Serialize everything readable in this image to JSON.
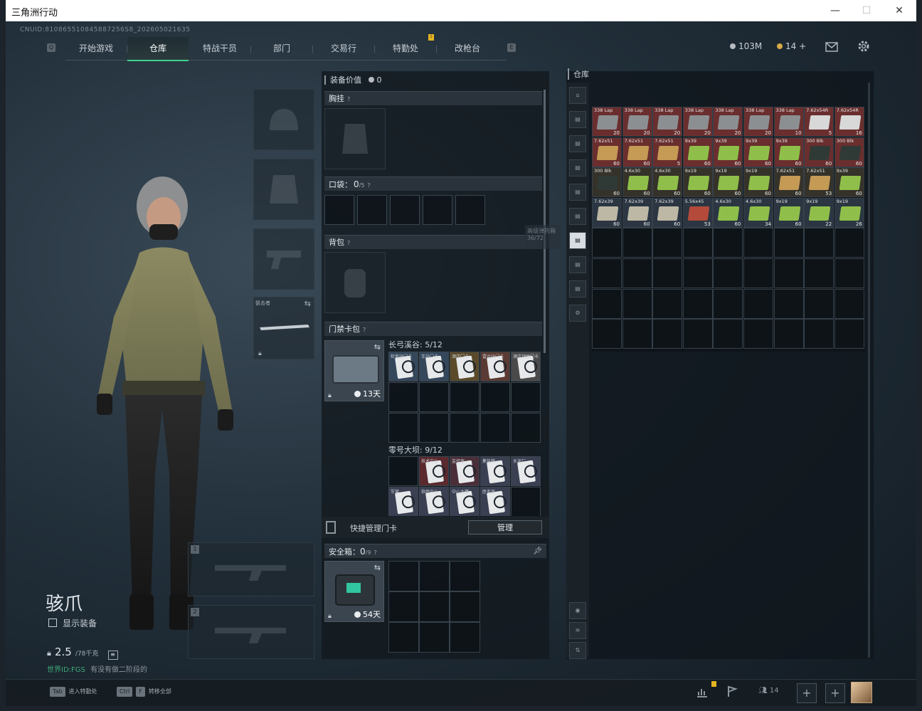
{
  "window": {
    "title": "三角洲行动",
    "minimize": "—",
    "maximize": "☐",
    "close": "✕"
  },
  "cnuid": "CNUID:810865510845887256S8_202605021635",
  "nav": {
    "left_key": "Q",
    "right_key": "E",
    "tabs": [
      {
        "label": "开始游戏"
      },
      {
        "label": "仓库",
        "active": true
      },
      {
        "label": "特战干员"
      },
      {
        "label": "部门"
      },
      {
        "label": "交易行"
      },
      {
        "label": "特勤处",
        "badge": "!"
      },
      {
        "label": "改枪台"
      }
    ]
  },
  "currency": {
    "silver": "103M",
    "gold": "14 +",
    "mail_icon": "mail-icon",
    "settings_icon": "gear-icon"
  },
  "character": {
    "name": "骇爪",
    "show_gear": "显示装备",
    "weight": "2.5",
    "weight_max": "/78千克",
    "footer_note_a": "世界ID:FGS",
    "footer_note_b": "有没有做二阶段的"
  },
  "left_slots": {
    "sniper_label": "狙击者",
    "slot1": "1",
    "slot2": "2"
  },
  "equipment": {
    "value_label": "装备价值",
    "value": "0",
    "chest_rig": "胸挂",
    "pocket": "口袋：",
    "pocket_count": "0",
    "pocket_max": "/5",
    "backpack": "背包",
    "keycard_bag": "门禁卡包",
    "keycard_days": "13天",
    "map1_label": "长弓溪谷: 5/12",
    "map2_label": "零号大坝: 9/12",
    "quick_manage": "快捷管理门卡",
    "manage_btn": "管理",
    "safebox": "安全箱：",
    "safebox_count": "0",
    "safebox_max": "/9",
    "safebox_days": "54天",
    "tooltip_a": "高级弹药箱",
    "tooltip_b": "36/72",
    "map1_cards": [
      "检查站门卡",
      "车站门卡",
      "酒店门卡",
      "雷达站门卡",
      "酒店顶层门卡"
    ],
    "map2_cards": [
      "技术中心",
      "监控室",
      "集装箱",
      "水泥厂",
      "军营",
      "指挥中心",
      "中心大楼",
      "医务室"
    ]
  },
  "warehouse": {
    "title": "仓库",
    "ammo": [
      {
        "name": "338 Lap",
        "count": "20",
        "color": "#6a2e2e"
      },
      {
        "name": "338 Lap",
        "count": "20",
        "color": "#6a2e2e"
      },
      {
        "name": "338 Lap",
        "count": "20",
        "color": "#6a2e2e"
      },
      {
        "name": "338 Lap",
        "count": "20",
        "color": "#6a2e2e"
      },
      {
        "name": "338 Lap",
        "count": "20",
        "color": "#6a2e2e"
      },
      {
        "name": "338 Lap",
        "count": "20",
        "color": "#6a2e2e"
      },
      {
        "name": "338 Lap",
        "count": "10",
        "color": "#6a2e2e"
      },
      {
        "name": "7.62x54R",
        "count": "5",
        "color": "#6a2e2e"
      },
      {
        "name": "7.62x54R",
        "count": "16",
        "color": "#6a2e2e"
      },
      {
        "name": "7.62x51",
        "count": "60",
        "color": "#6a2e2e"
      },
      {
        "name": "7.62x51",
        "count": "60",
        "color": "#6a2e2e"
      },
      {
        "name": "7.62x51",
        "count": "5",
        "color": "#6a2e2e"
      },
      {
        "name": "9x39",
        "count": "60",
        "color": "#6a2e2e"
      },
      {
        "name": "9x39",
        "count": "60",
        "color": "#6a2e2e"
      },
      {
        "name": "9x39",
        "count": "60",
        "color": "#6a2e2e"
      },
      {
        "name": "9x39",
        "count": "60",
        "color": "#6a2e2e"
      },
      {
        "name": "300 Blk",
        "count": "60",
        "color": "#6a2e2e"
      },
      {
        "name": "300 Blk",
        "count": "60",
        "color": "#6a2e2e"
      },
      {
        "name": "300 Blk",
        "count": "60",
        "color": "#35322a"
      },
      {
        "name": "4.6x30",
        "count": "60",
        "color": "#35322a"
      },
      {
        "name": "4.6x30",
        "count": "60",
        "color": "#35322a"
      },
      {
        "name": "9x19",
        "count": "60",
        "color": "#35322a"
      },
      {
        "name": "9x19",
        "count": "60",
        "color": "#35322a"
      },
      {
        "name": "9x19",
        "count": "60",
        "color": "#35322a"
      },
      {
        "name": "7.62x51",
        "count": "60",
        "color": "#35322a"
      },
      {
        "name": "7.62x51",
        "count": "53",
        "color": "#35322a"
      },
      {
        "name": "9x39",
        "count": "60",
        "color": "#35322a"
      },
      {
        "name": "7.62x39",
        "count": "60",
        "color": "#2b3642"
      },
      {
        "name": "7.62x39",
        "count": "60",
        "color": "#2b3642"
      },
      {
        "name": "7.62x39",
        "count": "60",
        "color": "#2b3642"
      },
      {
        "name": "5.56x45",
        "count": "53",
        "color": "#2b3642"
      },
      {
        "name": "4.6x30",
        "count": "60",
        "color": "#2b3642"
      },
      {
        "name": "4.6x30",
        "count": "34",
        "color": "#2b3642"
      },
      {
        "name": "9x19",
        "count": "60",
        "color": "#2b3642"
      },
      {
        "name": "9x19",
        "count": "22",
        "color": "#2b3642"
      },
      {
        "name": "9x19",
        "count": "26",
        "color": "#2b3642"
      }
    ],
    "box_colors": [
      "#8c8f92",
      "#8c8f92",
      "#8c8f92",
      "#8c8f92",
      "#8c8f92",
      "#8c8f92",
      "#8c8f92",
      "#d8d8d8",
      "#d8d8d8",
      "#c49a55",
      "#c49a55",
      "#c49a55",
      "#8fbf4a",
      "#8fbf4a",
      "#8fbf4a",
      "#8fbf4a",
      "#2f3a36",
      "#2f3a36",
      "#2f3a36",
      "#8fbf4a",
      "#8fbf4a",
      "#8fbf4a",
      "#8fbf4a",
      "#8fbf4a",
      "#c49a55",
      "#c49a55",
      "#8fbf4a",
      "#bdb8a6",
      "#bdb8a6",
      "#bdb8a6",
      "#b34a3a",
      "#8fbf4a",
      "#8fbf4a",
      "#8fbf4a",
      "#8fbf4a",
      "#8fbf4a"
    ]
  },
  "bottom": {
    "tab_key": "Tab",
    "tab_action": "进入特勤处",
    "ctrl_key": "Ctrl",
    "f_key": "F",
    "transfer_all": "转移全部",
    "friends": "14",
    "plus": "+"
  },
  "colors": {
    "accent": "#3fd18a",
    "badge": "#e6b422"
  }
}
